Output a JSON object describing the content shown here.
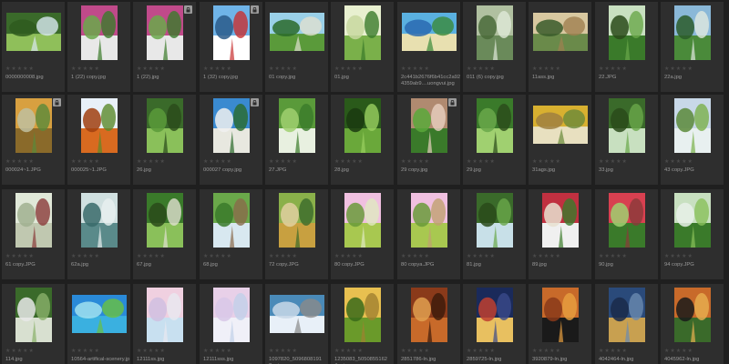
{
  "window": {
    "title": ""
  },
  "grid": {
    "rows": [
      {
        "items": [
          {
            "file": "0000000008.jpg",
            "rating": 0,
            "locked": false,
            "icon": "thumbnail-waterfall",
            "palette": [
              "#3a6a2a",
              "#8fbf5a",
              "#d8e8f0",
              "#2f5a1e"
            ]
          },
          {
            "file": "1 (22) copy.jpg",
            "rating": 0,
            "locked": false,
            "icon": "thumbnail-house-garden",
            "palette": [
              "#c04a8a",
              "#e8e8e8",
              "#3a7a2a",
              "#6aa84a"
            ]
          },
          {
            "file": "1 (22).jpg",
            "rating": 0,
            "locked": true,
            "icon": "thumbnail-house-garden",
            "palette": [
              "#c04a8a",
              "#e8e8e8",
              "#3a7a2a",
              "#6aa84a"
            ]
          },
          {
            "file": "1 (32) copy.jpg",
            "rating": 0,
            "locked": true,
            "icon": "thumbnail-city-tower",
            "palette": [
              "#6fb4e8",
              "#ffffff",
              "#c83030",
              "#2a5a8a"
            ]
          },
          {
            "file": "01 copy.jpg",
            "rating": 0,
            "locked": false,
            "icon": "thumbnail-landscape",
            "palette": [
              "#9ad0e8",
              "#5a9a3a",
              "#e0e0d0",
              "#2a6a2a"
            ]
          },
          {
            "file": "01.jpg",
            "rating": 0,
            "locked": false,
            "icon": "thumbnail-green-path",
            "palette": [
              "#e8f0d0",
              "#7ab04a",
              "#3a7a2a",
              "#c8d8a0"
            ]
          },
          {
            "file": "2c441b2676f6b41cc2a924359ab9....uongvui.jpg",
            "rating": 0,
            "locked": false,
            "icon": "thumbnail-tropical-pool",
            "palette": [
              "#5ab0e0",
              "#e8e0b0",
              "#3a8a3a",
              "#2a6ab0"
            ]
          },
          {
            "file": "011 (6) copy.jpg",
            "rating": 0,
            "locked": false,
            "icon": "thumbnail-forest-light",
            "palette": [
              "#b0c0a0",
              "#6a8a5a",
              "#e0e8d8",
              "#4a6a3a"
            ]
          },
          {
            "file": "11ass.jpg",
            "rating": 0,
            "locked": false,
            "icon": "thumbnail-autumn",
            "palette": [
              "#d8c8a0",
              "#6a8a4a",
              "#a08050",
              "#3a5a2a"
            ]
          },
          {
            "file": "22.JPG",
            "rating": 0,
            "locked": false,
            "icon": "thumbnail-forest",
            "palette": [
              "#c8e0c0",
              "#3a7a2a",
              "#6aa84a",
              "#2a4a1a"
            ]
          },
          {
            "file": "22a.jpg",
            "rating": 0,
            "locked": false,
            "icon": "thumbnail-lake",
            "palette": [
              "#8ab8d8",
              "#4a8a3a",
              "#e0e8e0",
              "#2a5a2a"
            ]
          }
        ]
      },
      {
        "items": [
          {
            "file": "000024~1.JPG",
            "rating": 0,
            "locked": true,
            "icon": "thumbnail-autumn-path",
            "palette": [
              "#d8a040",
              "#8a6a2a",
              "#5a8a3a",
              "#c0c0a0"
            ]
          },
          {
            "file": "000025~1.JPG",
            "rating": 0,
            "locked": false,
            "icon": "thumbnail-autumn-tree",
            "palette": [
              "#e8f0f8",
              "#d86a20",
              "#5a8a2a",
              "#a04010"
            ]
          },
          {
            "file": "26.jpg",
            "rating": 0,
            "locked": false,
            "icon": "thumbnail-forest",
            "palette": [
              "#3a6a2a",
              "#8ac05a",
              "#2a4a1a",
              "#5a9a3a"
            ]
          },
          {
            "file": "000027 copy.jpg",
            "rating": 0,
            "locked": true,
            "icon": "thumbnail-beach-palm",
            "palette": [
              "#3a8ad0",
              "#e8e8e0",
              "#2a6a2a",
              "#f0f0f0"
            ]
          },
          {
            "file": "27.JPG",
            "rating": 0,
            "locked": false,
            "icon": "thumbnail-garden",
            "palette": [
              "#5a9a3a",
              "#e8f0e0",
              "#3a7a2a",
              "#a0d070"
            ]
          },
          {
            "file": "28.jpg",
            "rating": 0,
            "locked": false,
            "icon": "thumbnail-mirror-forest",
            "palette": [
              "#2a5a1a",
              "#6aa83a",
              "#9ad060",
              "#1a3a10"
            ]
          },
          {
            "file": "29 copy.jpg",
            "rating": 0,
            "locked": true,
            "icon": "thumbnail-cottage",
            "palette": [
              "#b08a70",
              "#3a7a2a",
              "#e8d0c0",
              "#5aa83a"
            ]
          },
          {
            "file": "29.jpg",
            "rating": 0,
            "locked": false,
            "icon": "thumbnail-forest",
            "palette": [
              "#3a7a2a",
              "#a0d070",
              "#2a4a1a",
              "#6aa84a"
            ]
          },
          {
            "file": "31ags.jpg",
            "rating": 0,
            "locked": false,
            "icon": "thumbnail-autumn-park",
            "palette": [
              "#d8b030",
              "#e8e0c0",
              "#6a8a3a",
              "#a08040"
            ]
          },
          {
            "file": "33.jpg",
            "rating": 0,
            "locked": false,
            "icon": "thumbnail-park-trees",
            "palette": [
              "#3a6a2a",
              "#c8e0c0",
              "#6aa84a",
              "#2a4a1a"
            ]
          },
          {
            "file": "43 copy.JPG",
            "rating": 0,
            "locked": false,
            "icon": "thumbnail-misty-park",
            "palette": [
              "#c8d8e8",
              "#e8f0f0",
              "#7ab04a",
              "#5a8a3a"
            ]
          }
        ]
      },
      {
        "items": [
          {
            "file": "61 copy.JPG",
            "rating": 0,
            "locked": false,
            "icon": "thumbnail-misty-building",
            "palette": [
              "#e0e8d8",
              "#c0c8b0",
              "#8a3a3a",
              "#a0b090"
            ]
          },
          {
            "file": "62a.jpg",
            "rating": 0,
            "locked": false,
            "icon": "thumbnail-misty-trees",
            "palette": [
              "#d0e0e0",
              "#5a8a8a",
              "#e8f0f0",
              "#3a6a6a"
            ]
          },
          {
            "file": "67.jpg",
            "rating": 0,
            "locked": false,
            "icon": "thumbnail-park-path",
            "palette": [
              "#3a7a2a",
              "#8ac05a",
              "#e0e0d0",
              "#2a4a1a"
            ]
          },
          {
            "file": "68.jpg",
            "rating": 0,
            "locked": false,
            "icon": "thumbnail-hillside-house",
            "palette": [
              "#6aa84a",
              "#d8e8f0",
              "#8a6a4a",
              "#3a7a2a"
            ]
          },
          {
            "file": "72 copy.JPG",
            "rating": 0,
            "locked": false,
            "icon": "thumbnail-palm-garden",
            "palette": [
              "#8ab04a",
              "#c8a040",
              "#3a6a2a",
              "#e0d0a0"
            ]
          },
          {
            "file": "80 copy.JPG",
            "rating": 0,
            "locked": false,
            "icon": "thumbnail-meadow-fence",
            "palette": [
              "#f0c0e0",
              "#a8c850",
              "#e0e8c0",
              "#6a9a3a"
            ]
          },
          {
            "file": "80 copya.JPG",
            "rating": 0,
            "locked": false,
            "icon": "thumbnail-meadow-fence",
            "palette": [
              "#f0c0e0",
              "#a8c850",
              "#c0a070",
              "#6a9a3a"
            ]
          },
          {
            "file": "81.jpg",
            "rating": 0,
            "locked": false,
            "icon": "thumbnail-waterfall",
            "palette": [
              "#3a6a2a",
              "#c8e0e8",
              "#6aa84a",
              "#2a4a1a"
            ]
          },
          {
            "file": "89.jpg",
            "rating": 0,
            "locked": false,
            "icon": "thumbnail-flower-walkway",
            "palette": [
              "#c03040",
              "#f0f0f0",
              "#3a7a2a",
              "#e8e0d0"
            ]
          },
          {
            "file": "90.jpg",
            "rating": 0,
            "locked": false,
            "icon": "thumbnail-flower-arch",
            "palette": [
              "#d84050",
              "#3a7a2a",
              "#8a3a3a",
              "#a0d070"
            ]
          },
          {
            "file": "94 copy.JPG",
            "rating": 0,
            "locked": false,
            "icon": "thumbnail-sunlit-forest",
            "palette": [
              "#c8e0c0",
              "#3a7a2a",
              "#8ac05a",
              "#e8f0e8"
            ]
          }
        ]
      },
      {
        "items": [
          {
            "file": "114.jpg",
            "rating": 0,
            "locked": false,
            "icon": "thumbnail-tree-lane",
            "palette": [
              "#3a6a2a",
              "#d8e0d0",
              "#8ab06a",
              "#e8e8e8"
            ]
          },
          {
            "file": "10564-artifical-scenery.jpg",
            "rating": 0,
            "locked": false,
            "icon": "thumbnail-lake-island",
            "palette": [
              "#2a8ad8",
              "#3ab0e0",
              "#6ac040",
              "#a0e0f0"
            ]
          },
          {
            "file": "12111ss.jpg",
            "rating": 0,
            "locked": false,
            "icon": "thumbnail-pastel-mist",
            "palette": [
              "#f0d0e0",
              "#c8e0f0",
              "#e8e8f0",
              "#d0c0e0"
            ]
          },
          {
            "file": "12111sss.jpg",
            "rating": 0,
            "locked": false,
            "icon": "thumbnail-pastel-mist",
            "palette": [
              "#e8d0e8",
              "#f0f0f8",
              "#c0d0e8",
              "#d8c8e8"
            ]
          },
          {
            "file": "1097820_50968081912....jpg",
            "rating": 0,
            "locked": false,
            "icon": "thumbnail-waterfall-city",
            "palette": [
              "#4a8ab8",
              "#e8f0f8",
              "#8a8a8a",
              "#c8d8e8"
            ]
          },
          {
            "file": "1235083_50508551624....jpg",
            "rating": 0,
            "locked": false,
            "icon": "thumbnail-autumn-forest",
            "palette": [
              "#e8c050",
              "#6a9a2a",
              "#a08030",
              "#3a6a1a"
            ]
          },
          {
            "file": "2851786-ln.jpg",
            "rating": 0,
            "locked": false,
            "icon": "thumbnail-autumn-road",
            "palette": [
              "#8a3a1a",
              "#c86a2a",
              "#3a1a0a",
              "#e0a050"
            ]
          },
          {
            "file": "2859725-ln.jpg",
            "rating": 0,
            "locked": false,
            "icon": "thumbnail-temple-night",
            "palette": [
              "#1a2a5a",
              "#e8c060",
              "#3a4a8a",
              "#c04030"
            ]
          },
          {
            "file": "3920879-ln.jpg",
            "rating": 0,
            "locked": false,
            "icon": "thumbnail-autumn-leaves",
            "palette": [
              "#c86a2a",
              "#1a1a1a",
              "#e8a040",
              "#8a3a1a"
            ]
          },
          {
            "file": "4042464-ln.jpg",
            "rating": 0,
            "locked": false,
            "icon": "thumbnail-lake-reflection",
            "palette": [
              "#2a4a7a",
              "#c8a050",
              "#6a8ab0",
              "#1a2a4a"
            ]
          },
          {
            "file": "4045962-ln.jpg",
            "rating": 0,
            "locked": false,
            "icon": "thumbnail-autumn-path",
            "palette": [
              "#c86a2a",
              "#3a6a2a",
              "#e8b050",
              "#1a1a1a"
            ]
          }
        ]
      }
    ]
  }
}
